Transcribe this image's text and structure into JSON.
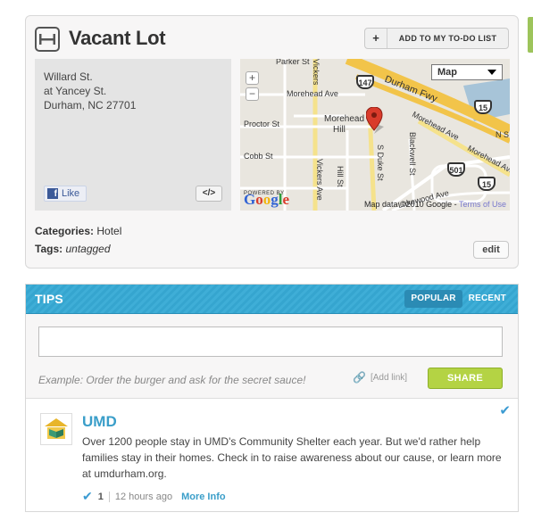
{
  "venue": {
    "title": "Vacant Lot",
    "todo_button": {
      "plus": "+",
      "label": "ADD TO MY TO-DO LIST"
    },
    "address": [
      "Willard St.",
      "at Yancey St.",
      "Durham, NC 27701"
    ],
    "like_label": "Like",
    "embed_label": "</>",
    "categories_label": "Categories:",
    "categories_value": "Hotel",
    "tags_label": "Tags:",
    "tags_value": "untagged",
    "edit_label": "edit"
  },
  "map": {
    "map_type": "Map",
    "streets": [
      "Parker St",
      "Vickers",
      "Morehead Ave",
      "Durham Fwy",
      "Proctor St",
      "Morehead",
      "Hill",
      "Morehead Ave",
      "N S",
      "Cobb St",
      "Vickers Ave",
      "Hill St",
      "S Duke St",
      "Blackwell St",
      "Morehead Ave",
      "Lakewood Ave"
    ],
    "shields": [
      "147",
      "15",
      "501",
      "15"
    ],
    "powered_by": "POWERED BY",
    "google": "Google",
    "credit": "Map data ©2010 Google - ",
    "terms": "Terms of Use"
  },
  "tips": {
    "title": "TIPS",
    "tabs": [
      "POPULAR",
      "RECENT"
    ],
    "input_placeholder": "",
    "example": "Example: Order the burger and ask for the secret sauce!",
    "add_link": "[Add link]",
    "share_label": "SHARE",
    "items": [
      {
        "author": "UMD",
        "text": "Over 1200 people stay in UMD's Community Shelter each year. But we'd rather help families stay in their homes. Check in to raise awareness about our cause, or learn more at umdurham.org.",
        "count": "1",
        "time": "12 hours ago",
        "more_info": "More Info"
      }
    ]
  },
  "colors": {
    "tips_blue": "#35a5cf",
    "share_green": "#b4d344",
    "link_blue": "#3a9ec9",
    "pin_red": "#d93b2b"
  }
}
